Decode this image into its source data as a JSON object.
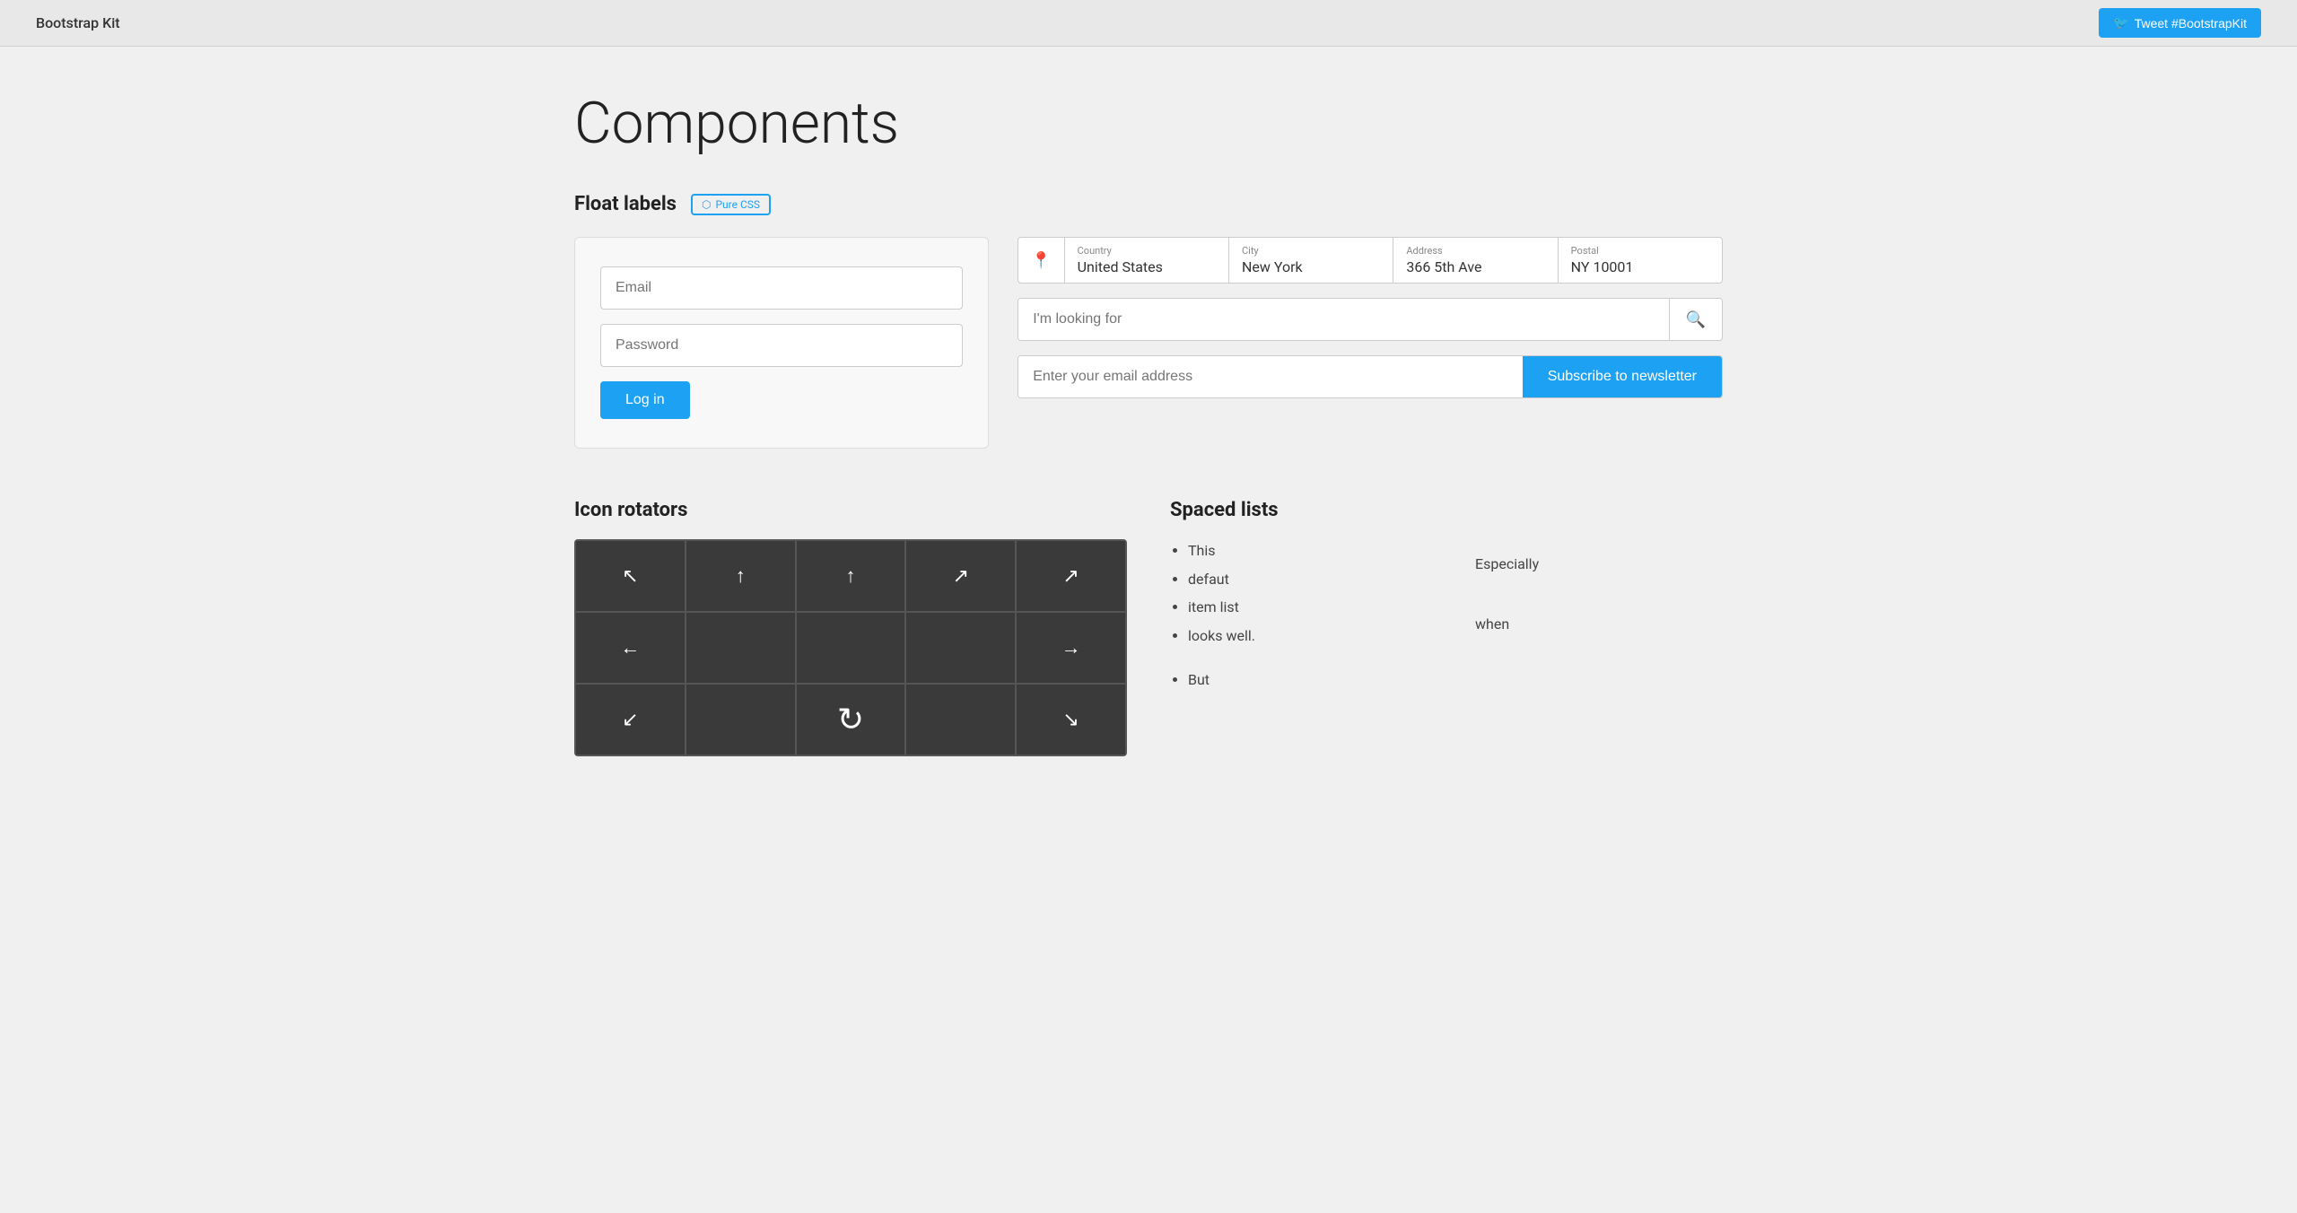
{
  "navbar": {
    "brand": "Bootstrap Kit",
    "tweet_btn": "Tweet #BootstrapKit"
  },
  "page": {
    "title": "Components"
  },
  "float_labels": {
    "section_title": "Float labels",
    "badge": "Pure CSS",
    "login": {
      "email_placeholder": "Email",
      "password_placeholder": "Password",
      "login_btn": "Log in"
    },
    "address": {
      "pin_icon": "📍",
      "country_label": "Country",
      "country_value": "United States",
      "city_label": "City",
      "city_value": "New York",
      "address_label": "Address",
      "address_value": "366 5th Ave",
      "postal_label": "Postal",
      "postal_value": "NY 10001"
    },
    "search": {
      "placeholder": "I'm looking for",
      "search_icon": "🔍"
    },
    "newsletter": {
      "placeholder": "Enter your email address",
      "subscribe_btn": "Subscribe to newsletter"
    }
  },
  "icon_rotators": {
    "title": "Icon rotators",
    "icons": [
      "↖",
      "↑",
      "↑",
      "↗",
      "↗",
      "←",
      "",
      "",
      "",
      "→",
      "↙",
      "",
      "↻",
      "",
      "↘"
    ]
  },
  "spaced_lists": {
    "title": "Spaced lists",
    "list_items": [
      "This",
      "defaut",
      "item list",
      "looks well.",
      "",
      "But"
    ],
    "cards": [
      "Especially",
      "when"
    ]
  }
}
